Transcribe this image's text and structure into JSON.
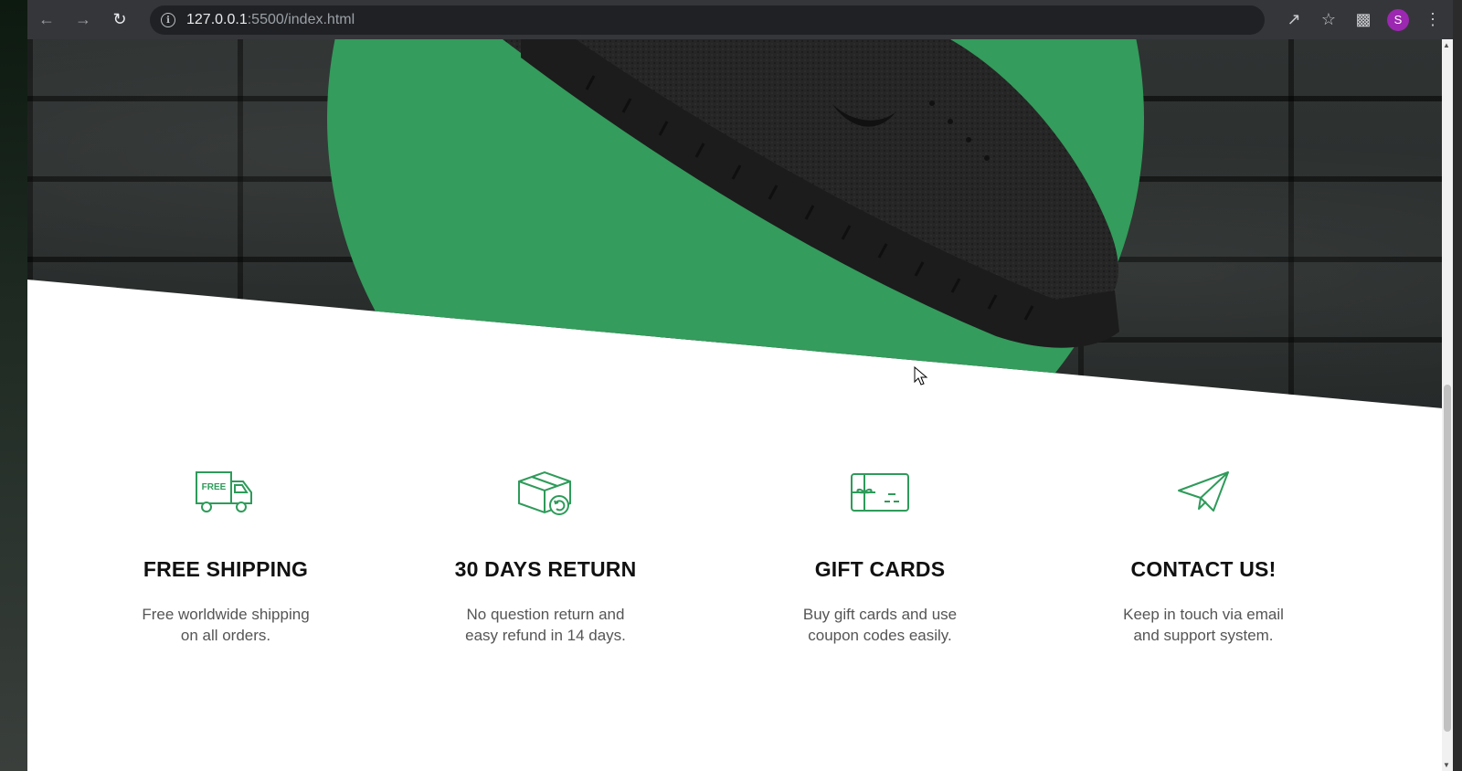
{
  "browser": {
    "url_host": "127.0.0.1",
    "url_path": ":5500/index.html",
    "profile_initial": "S",
    "profile_color": "#9c27b0"
  },
  "hero": {
    "accent_color": "#349c5c"
  },
  "features": [
    {
      "icon": "delivery-truck-icon",
      "icon_label": "FREE",
      "title": "FREE SHIPPING",
      "text": "Free worldwide shipping on all orders."
    },
    {
      "icon": "return-box-icon",
      "title": "30 DAYS RETURN",
      "text": "No question return and easy refund in 14 days."
    },
    {
      "icon": "gift-card-icon",
      "title": "GIFT CARDS",
      "text": "Buy gift cards and use coupon codes easily."
    },
    {
      "icon": "paper-plane-icon",
      "title": "CONTACT US!",
      "text": "Keep in touch via email and support system."
    }
  ]
}
